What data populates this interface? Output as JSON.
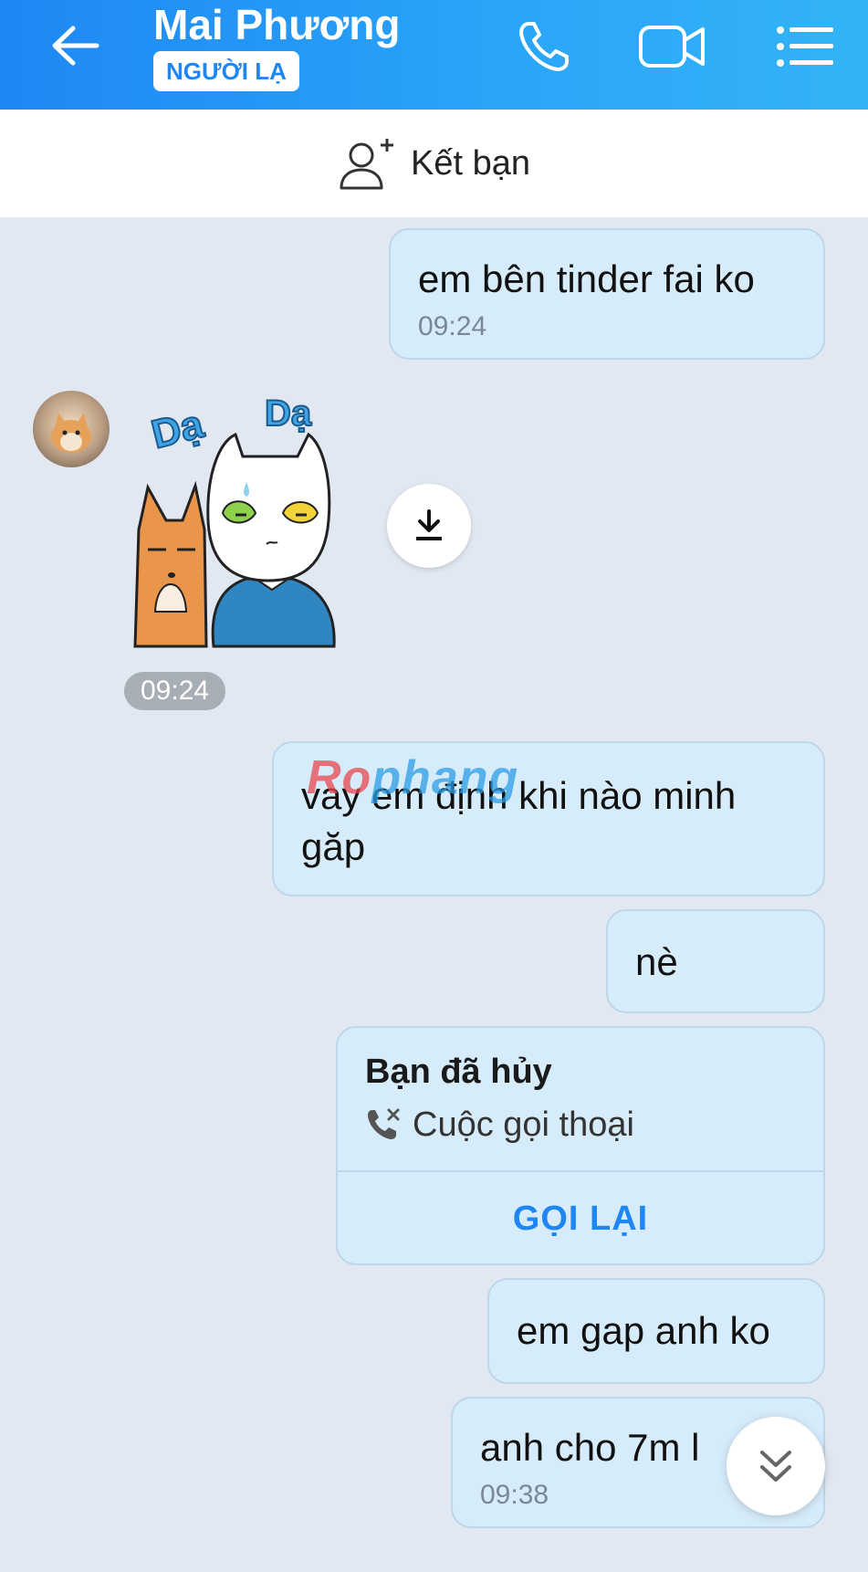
{
  "header": {
    "contact_name": "Mai Phương",
    "badge": "NGƯỜI LẠ",
    "colors": {
      "gradient_start": "#1f87f5",
      "gradient_end": "#33b3f7"
    },
    "icons": [
      "back-arrow-icon",
      "phone-icon",
      "video-call-icon",
      "menu-list-icon"
    ]
  },
  "add_friend": {
    "label": "Kết bạn",
    "icon": "add-person-icon"
  },
  "messages": [
    {
      "side": "right",
      "text": "em bên tinder fai ko",
      "time": "09:24"
    },
    {
      "side": "left",
      "type": "sticker",
      "sticker_text": [
        "Dạ",
        "Dạ"
      ],
      "time": "09:24"
    },
    {
      "side": "right",
      "text": "vay em định khi nào minh găp"
    },
    {
      "side": "right",
      "text": "nè"
    },
    {
      "side": "right",
      "type": "call",
      "title": "Bạn đã hủy",
      "subtitle": "Cuộc gọi thoại",
      "action": "GỌI LẠI"
    },
    {
      "side": "right",
      "text": "em gap anh ko"
    },
    {
      "side": "right",
      "text": "anh cho 7m l",
      "time": "09:38"
    }
  ],
  "watermark": {
    "part1": "Ro",
    "part2": "phang"
  }
}
